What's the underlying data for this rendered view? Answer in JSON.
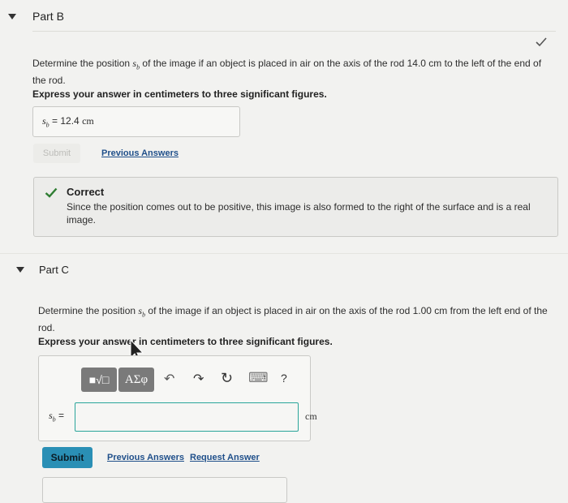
{
  "partB": {
    "title": "Part B",
    "question_pre": "Determine the position ",
    "var": "s",
    "var_sub": "b",
    "question_post": " of the image if an object is placed in air on the axis of the rod 14.0 cm to the left of the end of the rod.",
    "instruction": "Express your answer in centimeters to three significant figures.",
    "answer_lhs": "s",
    "answer_sub": "b",
    "answer_eq": " = ",
    "answer_value": "12.4",
    "answer_unit": "cm",
    "submit_label": "Submit",
    "prev_answers": "Previous Answers",
    "feedback_title": "Correct",
    "feedback_text": "Since the position comes out to be positive, this image is also formed to the right of the surface and is a real image."
  },
  "partC": {
    "title": "Part C",
    "question_pre": "Determine the position ",
    "var": "s",
    "var_sub": "b",
    "question_post": " of the image if an object is placed in air on the axis of the rod 1.00 cm from the left end of the rod.",
    "instruction": "Express your answer in centimeters to three significant figures.",
    "toolbar": {
      "templates_label": "■√□",
      "symbols_label": "ΑΣφ",
      "undo": "↶",
      "redo": "↷",
      "reset": "↻",
      "keyboard": "⌨",
      "help": "?"
    },
    "field_lhs": "s",
    "field_sub": "b",
    "field_eq": " =",
    "field_value": "",
    "unit": "cm",
    "submit_label": "Submit",
    "prev_answers": "Previous Answers",
    "request_answer": "Request Answer"
  },
  "colors": {
    "accent_teal": "#2a8fb5",
    "correct_green": "#2f7d32",
    "link_blue": "#1f4f8a"
  }
}
